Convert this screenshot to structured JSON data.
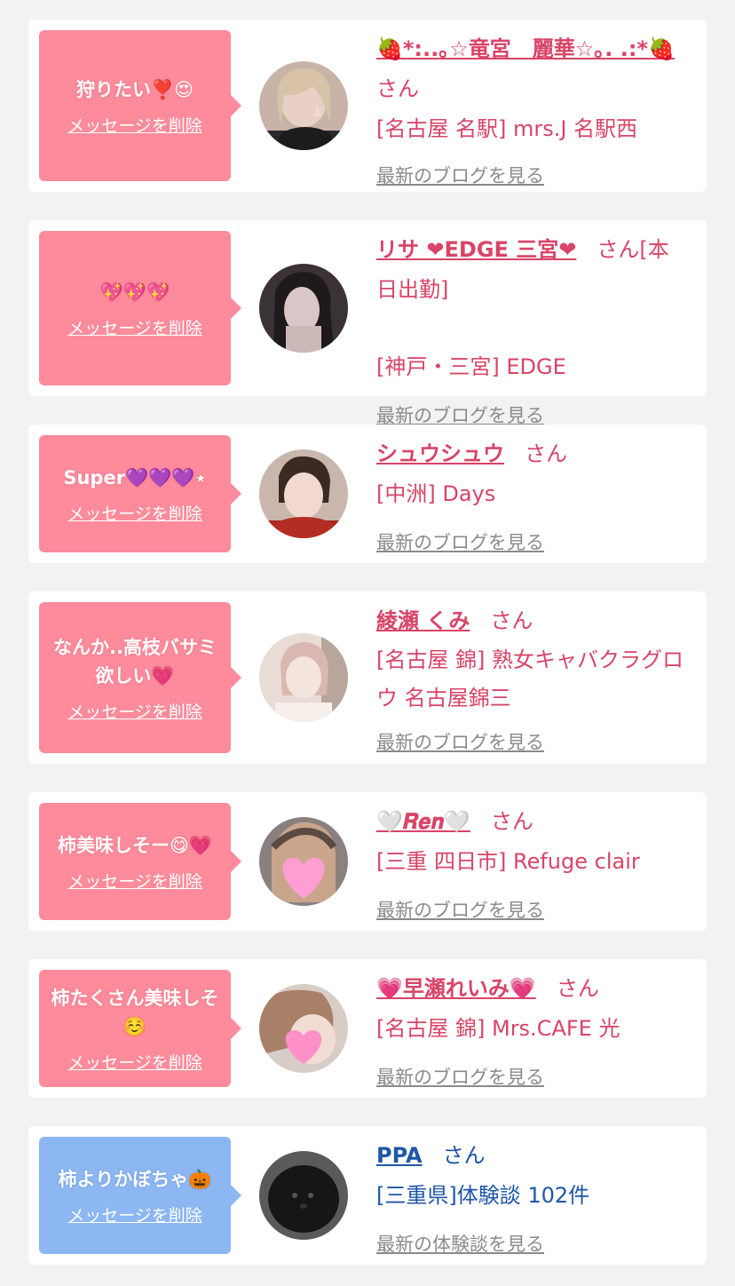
{
  "delete_label": "メッセージを削除",
  "items": [
    {
      "message": "狩りたい❣️😍",
      "name": "🍓*:..｡☆竜宮　麗華☆｡. .:*🍓",
      "san": "さん",
      "location": "[名古屋 名駅] mrs.J 名駅西",
      "link": "最新のブログを見る"
    },
    {
      "message": "💖💖💖",
      "name": "リサ ❤EDGE 三宮❤",
      "san": "さん[本日出勤]",
      "location": "[神戸・三宮] EDGE",
      "link": "最新のブログを見る"
    },
    {
      "message": "Super💜💜💜⋆",
      "name": "シュウシュウ",
      "san": "さん",
      "location": "[中洲] Days",
      "link": "最新のブログを見る"
    },
    {
      "message": "なんか..高枝バサミ欲しい💗",
      "name": "綾瀬 くみ",
      "san": "さん",
      "location": "[名古屋 錦] 熟女キャバクラグロウ 名古屋錦三",
      "link": "最新のブログを見る"
    },
    {
      "message": "柿美味しそー😋💗",
      "name": "🤍𝑹𝒆𝒏🤍",
      "san": "さん",
      "location": "[三重 四日市] Refuge clair",
      "link": "最新のブログを見る"
    },
    {
      "message": "柿たくさん美味しそ☺️",
      "name": "💗早瀬れいみ💗",
      "san": "さん",
      "location": "[名古屋 錦] Mrs.CAFE 光",
      "link": "最新のブログを見る"
    },
    {
      "message": "柿よりかぼちゃ🎃",
      "name": "PPA",
      "san": "さん",
      "location": "[三重県]体験談 102件",
      "link": "最新の体験談を見る"
    }
  ],
  "colors": {
    "pink_bubble": "#fd8b9b",
    "blue_bubble": "#8cb7f2",
    "pink_text": "#d94467",
    "blue_text": "#1e56a8",
    "link_gray": "#8a8a8a"
  }
}
